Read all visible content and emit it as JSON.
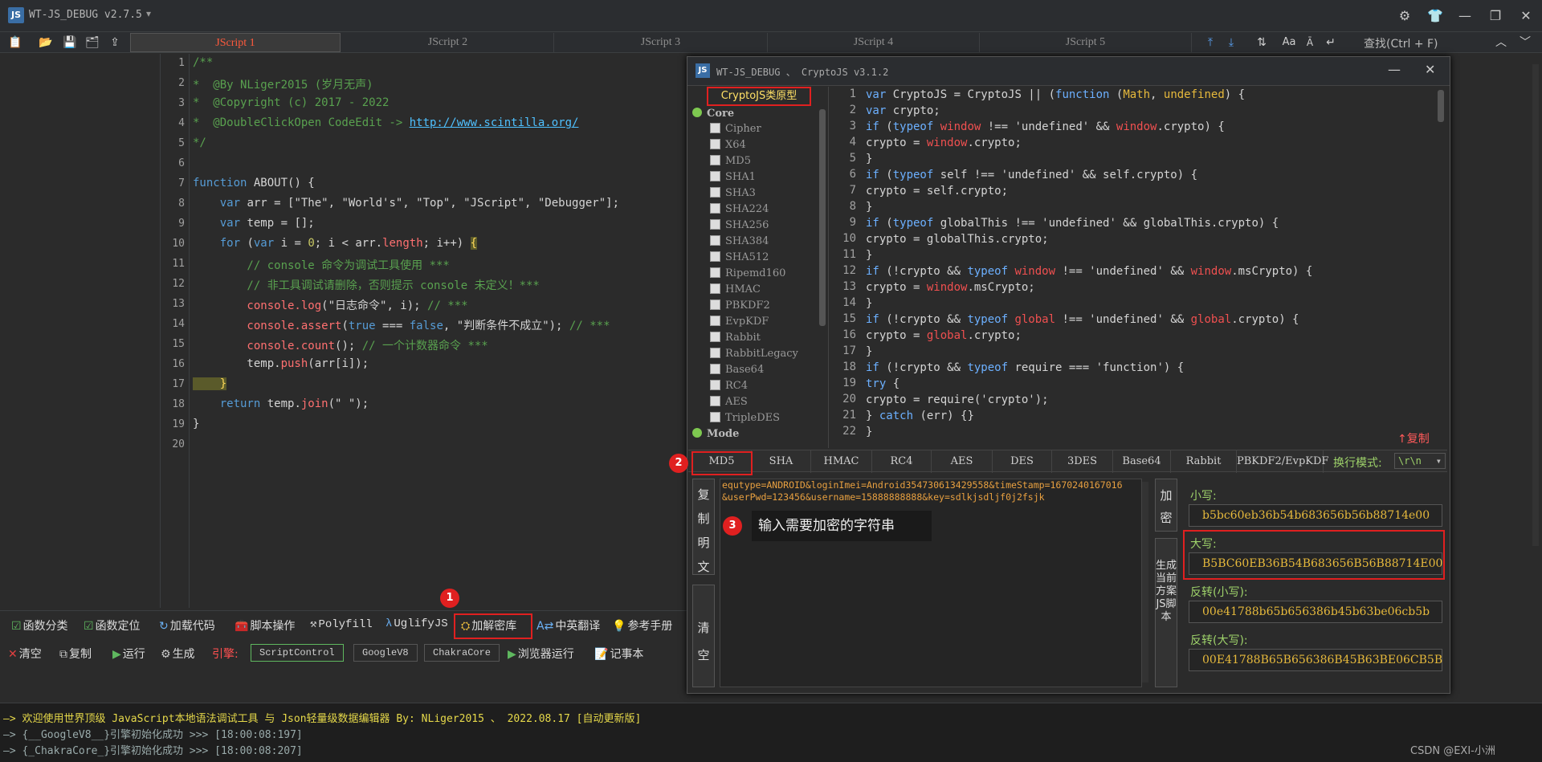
{
  "app": {
    "title": "WT-JS_DEBUG v2.7.5"
  },
  "tabs": [
    "JScript 1",
    "JScript 2",
    "JScript 3",
    "JScript 4",
    "JScript 5"
  ],
  "search_placeholder": "查找(Ctrl + F)",
  "editor": {
    "line_numbers": [
      "1",
      "2",
      "3",
      "4",
      "5",
      "6",
      "7",
      "8",
      "9",
      "10",
      "11",
      "12",
      "13",
      "14",
      "15",
      "16",
      "17",
      "18",
      "19",
      "20"
    ],
    "lines": {
      "l1": "/**",
      "l2": "*  @By NLiger2015 (岁月无声)",
      "l3": "*  @Copyright (c) 2017 - 2022",
      "l4a": "*  @DoubleClickOpen CodeEdit -> ",
      "l4b": "http://www.scintilla.org/",
      "l5": "*/",
      "l7a": "function",
      "l7b": " ABOUT() {",
      "l8a": "    var",
      "l8b": " arr = [\"The\", \"World's\", \"Top\", \"JScript\", \"Debugger\"];",
      "l9a": "    var",
      "l9b": " temp = [];",
      "l10a": "    for",
      "l10b": " (",
      "l10c": "var",
      "l10d": " i = ",
      "l10e": "0",
      "l10f": "; i < arr.",
      "l10g": "length",
      "l10h": "; i++) ",
      "l10i": "{",
      "l11": "        // console 命令为调试工具使用 ***",
      "l12": "        // 非工具调试请删除，否则提示 console 未定义！***",
      "l13a": "        console.log",
      "l13b": "(\"日志命令\", i); ",
      "l13c": "// ***",
      "l14a": "        console.assert",
      "l14b": "(",
      "l14c": "true",
      "l14d": " === ",
      "l14e": "false",
      "l14f": ", \"判断条件不成立\"); ",
      "l14g": "// ***",
      "l15a": "        console.count",
      "l15b": "(); ",
      "l15c": "// 一个计数器命令 ***",
      "l16a": "        temp.",
      "l16b": "push",
      "l16c": "(arr[i]);",
      "l17": "    }",
      "l18a": "    return",
      "l18b": " temp.",
      "l18c": "join",
      "l18d": "(\" \");",
      "l19": "}"
    }
  },
  "funcbar": [
    "函数分类",
    "函数定位",
    "加载代码",
    "脚本操作",
    "Polyfill",
    "UglifyJS",
    "加解密库",
    "中英翻译",
    "参考手册"
  ],
  "runbar": {
    "clear": "清空",
    "copy": "复制",
    "run": "运行",
    "gen": "生成",
    "engine_label": "引擎:",
    "engines": [
      "ScriptControl",
      "GoogleV8",
      "ChakraCore"
    ],
    "browser_run": "浏览器运行",
    "notepad": "记事本"
  },
  "output": [
    "—> 欢迎使用世界顶级 JavaScript本地语法调试工具 与 Json轻量级数据编辑器 By: NLiger2015 、 2022.08.17 [自动更新版]",
    "—> {__GoogleV8__}引擎初始化成功 >>> [18:00:08:197]",
    "—> {_ChakraCore_}引擎初始化成功 >>> [18:00:08:207]"
  ],
  "watermark": "CSDN @EXI-小洲",
  "crypto": {
    "title": "WT-JS_DEBUG 、 CryptoJS v3.1.2",
    "tree_header": "CryptoJS类原型",
    "group_core": "Core",
    "group_mode": "Mode",
    "items": [
      "Cipher",
      "X64",
      "MD5",
      "SHA1",
      "SHA3",
      "SHA224",
      "SHA256",
      "SHA384",
      "SHA512",
      "Ripemd160",
      "HMAC",
      "PBKDF2",
      "EvpKDF",
      "Rabbit",
      "RabbitLegacy",
      "Base64",
      "RC4",
      "AES",
      "TripleDES"
    ],
    "code_line_numbers": [
      "1",
      "2",
      "3",
      "4",
      "5",
      "6",
      "7",
      "8",
      "9",
      "10",
      "11",
      "12",
      "13",
      "14",
      "15",
      "16",
      "17",
      "18",
      "19",
      "20",
      "21",
      "22"
    ],
    "copy_link": "↑复制",
    "alg_tabs": [
      "MD5",
      "SHA",
      "HMAC",
      "RC4",
      "AES",
      "DES",
      "3DES",
      "Base64",
      "Rabbit",
      "PBKDF2/EvpKDF"
    ],
    "newline_label": "换行模式:",
    "newline_value": "\\r\\n",
    "copy_plain": "复制明文",
    "clear": "清空",
    "encrypt": "加密",
    "gen_script": "生成当前方案JS脚本",
    "input_text": "equtype=ANDROID&loginImei=Android354730613429558&timeStamp=1670240167016&userPwd=123456&username=15888888888&key=sdlkjsdljf0j2fsjk",
    "tooltip": "输入需要加密的字符串",
    "lower_label": "小写:",
    "lower_value": "b5bc60eb36b54b683656b56b88714e00",
    "upper_label": "大写:",
    "upper_value": "B5BC60EB36B54B683656B56B88714E00",
    "rev_lower_label": "反转(小写):",
    "rev_lower_value": "00e41788b65b656386b45b63be06cb5b",
    "rev_upper_label": "反转(大写):",
    "rev_upper_value": "00E41788B65B656386B45B63BE06CB5B"
  },
  "badges": [
    "1",
    "2",
    "3"
  ]
}
